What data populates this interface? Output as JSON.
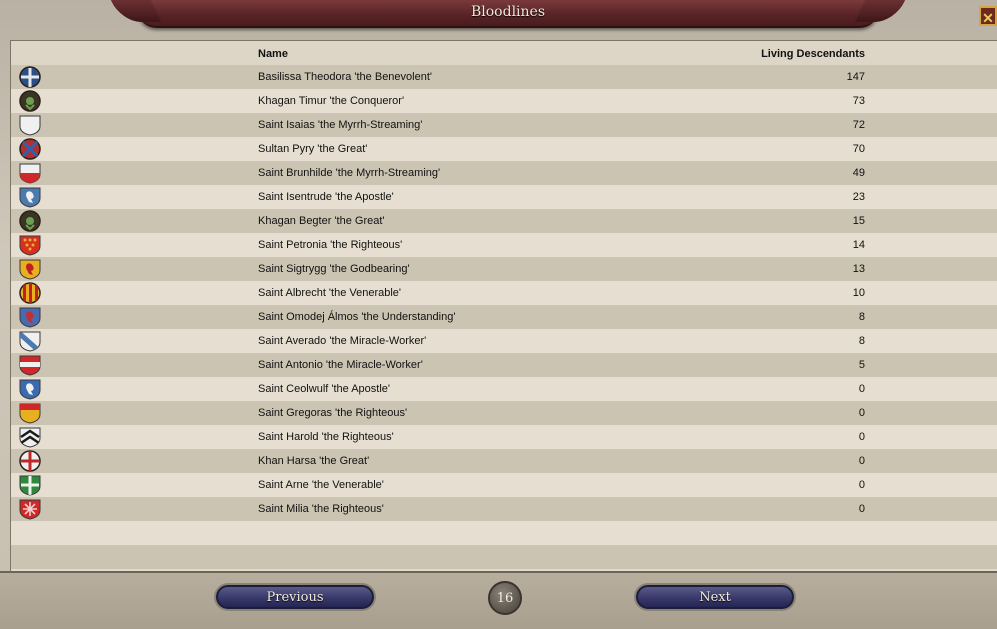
{
  "window": {
    "title": "Bloodlines",
    "close_label": "✕"
  },
  "table": {
    "headers": {
      "name": "Name",
      "living": "Living Descendants"
    },
    "rows": [
      {
        "name": "Basilissa Theodora 'the Benevolent'",
        "count": "147",
        "coa": {
          "shape": "round",
          "bg": "#2a4f8a",
          "fg": "#e8e8e8",
          "mark": "cross"
        }
      },
      {
        "name": "Khagan Timur 'the Conqueror'",
        "count": "73",
        "coa": {
          "shape": "round",
          "bg": "#3b3324",
          "fg": "#6aa050",
          "mark": "tamga"
        }
      },
      {
        "name": "Saint Isaias 'the Myrrh-Streaming'",
        "count": "72",
        "coa": {
          "shape": "shield",
          "bg": "#f0f0f0",
          "fg": "#dcdcdc",
          "mark": "none"
        }
      },
      {
        "name": "Sultan Pyry 'the Great'",
        "count": "70",
        "coa": {
          "shape": "round",
          "bg": "#b03030",
          "fg": "#3060b0",
          "mark": "saltire"
        }
      },
      {
        "name": "Saint Brunhilde 'the Myrrh-Streaming'",
        "count": "49",
        "coa": {
          "shape": "shield",
          "bg": "#f0f0f0",
          "fg": "#d02828",
          "mark": "base"
        }
      },
      {
        "name": "Saint Isentrude 'the Apostle'",
        "count": "23",
        "coa": {
          "shape": "shield",
          "bg": "#4a7ab0",
          "fg": "#f0f0f0",
          "mark": "lion"
        }
      },
      {
        "name": "Khagan Begter 'the Great'",
        "count": "15",
        "coa": {
          "shape": "round",
          "bg": "#3b3324",
          "fg": "#6aa050",
          "mark": "tamga"
        }
      },
      {
        "name": "Saint Petronia 'the Righteous'",
        "count": "14",
        "coa": {
          "shape": "shield",
          "bg": "#d83020",
          "fg": "#e8b030",
          "mark": "dots"
        }
      },
      {
        "name": "Saint Sigtrygg 'the Godbearing'",
        "count": "13",
        "coa": {
          "shape": "shield",
          "bg": "#e8b020",
          "fg": "#c02020",
          "mark": "lion"
        }
      },
      {
        "name": "Saint Albrecht 'the Venerable'",
        "count": "10",
        "coa": {
          "shape": "round",
          "bg": "#e8b020",
          "fg": "#c02020",
          "mark": "pales"
        }
      },
      {
        "name": "Saint Omodej Álmos 'the Understanding'",
        "count": "8",
        "coa": {
          "shape": "shield",
          "bg": "#4a6ab0",
          "fg": "#c03030",
          "mark": "lion"
        }
      },
      {
        "name": "Saint Averado 'the Miracle-Worker'",
        "count": "8",
        "coa": {
          "shape": "shield",
          "bg": "#f0f0f0",
          "fg": "#4a7ab0",
          "mark": "bend"
        }
      },
      {
        "name": "Saint Antonio 'the Miracle-Worker'",
        "count": "5",
        "coa": {
          "shape": "shield",
          "bg": "#d02828",
          "fg": "#f0f0f0",
          "mark": "fess"
        }
      },
      {
        "name": "Saint Ceolwulf 'the Apostle'",
        "count": "0",
        "coa": {
          "shape": "shield",
          "bg": "#3a6ab0",
          "fg": "#f0f0f0",
          "mark": "lion"
        }
      },
      {
        "name": "Saint Gregoras 'the Righteous'",
        "count": "0",
        "coa": {
          "shape": "shield",
          "bg": "#e8b020",
          "fg": "#d02828",
          "mark": "chief"
        }
      },
      {
        "name": "Saint Harold 'the Righteous'",
        "count": "0",
        "coa": {
          "shape": "shield",
          "bg": "#f0f0f0",
          "fg": "#1a1a1a",
          "mark": "chevrons"
        }
      },
      {
        "name": "Khan Harsa 'the Great'",
        "count": "0",
        "coa": {
          "shape": "round",
          "bg": "#f0f0f0",
          "fg": "#c02828",
          "mark": "cross"
        }
      },
      {
        "name": "Saint Arne 'the Venerable'",
        "count": "0",
        "coa": {
          "shape": "shield",
          "bg": "#2e8a3a",
          "fg": "#f0f0f0",
          "mark": "cross"
        }
      },
      {
        "name": "Saint Milia 'the Righteous'",
        "count": "0",
        "coa": {
          "shape": "shield",
          "bg": "#d02828",
          "fg": "#f0d0d0",
          "mark": "star"
        }
      }
    ]
  },
  "pagination": {
    "previous_label": "Previous",
    "next_label": "Next",
    "page": "16"
  }
}
